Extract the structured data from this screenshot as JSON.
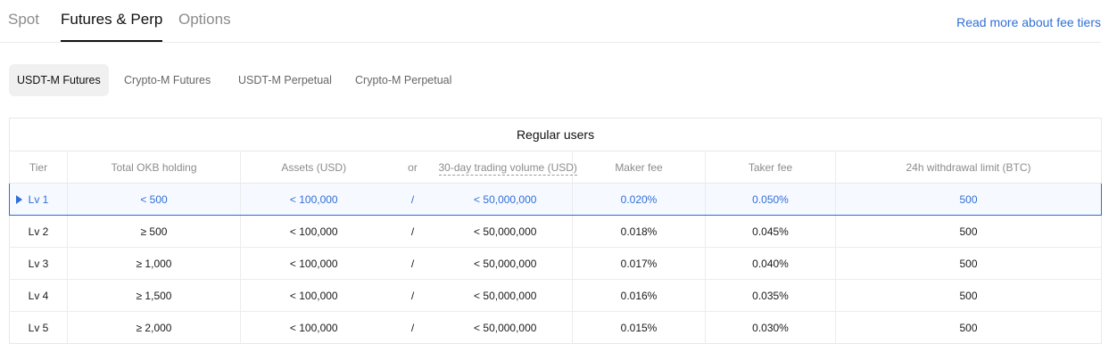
{
  "top_tabs": [
    "Spot",
    "Futures & Perp",
    "Options"
  ],
  "fee_link": "Read more about fee tiers",
  "sub_tabs": [
    "USDT-M Futures",
    "Crypto-M Futures",
    "USDT-M Perpetual",
    "Crypto-M Perpetual"
  ],
  "table": {
    "caption": "Regular users",
    "headers": {
      "tier": "Tier",
      "okb": "Total OKB holding",
      "assets": "Assets (USD)",
      "or": "or",
      "volume": "30-day trading volume (USD)",
      "maker": "Maker fee",
      "taker": "Taker fee",
      "withdrawal": "24h withdrawal limit (BTC)"
    },
    "rows": [
      {
        "tier": "Lv 1",
        "okb": "< 500",
        "assets": "< 100,000",
        "sep": "/",
        "volume": "< 50,000,000",
        "maker": "0.020%",
        "taker": "0.050%",
        "withdrawal": "500"
      },
      {
        "tier": "Lv 2",
        "okb": "≥ 500",
        "assets": "< 100,000",
        "sep": "/",
        "volume": "< 50,000,000",
        "maker": "0.018%",
        "taker": "0.045%",
        "withdrawal": "500"
      },
      {
        "tier": "Lv 3",
        "okb": "≥ 1,000",
        "assets": "< 100,000",
        "sep": "/",
        "volume": "< 50,000,000",
        "maker": "0.017%",
        "taker": "0.040%",
        "withdrawal": "500"
      },
      {
        "tier": "Lv 4",
        "okb": "≥ 1,500",
        "assets": "< 100,000",
        "sep": "/",
        "volume": "< 50,000,000",
        "maker": "0.016%",
        "taker": "0.035%",
        "withdrawal": "500"
      },
      {
        "tier": "Lv 5",
        "okb": "≥ 2,000",
        "assets": "< 100,000",
        "sep": "/",
        "volume": "< 50,000,000",
        "maker": "0.015%",
        "taker": "0.030%",
        "withdrawal": "500"
      }
    ]
  },
  "colors": {
    "accent": "#2f6fd6",
    "text": "#1a1a1a",
    "muted": "#8c8c8c",
    "border": "#e8e8e8"
  }
}
